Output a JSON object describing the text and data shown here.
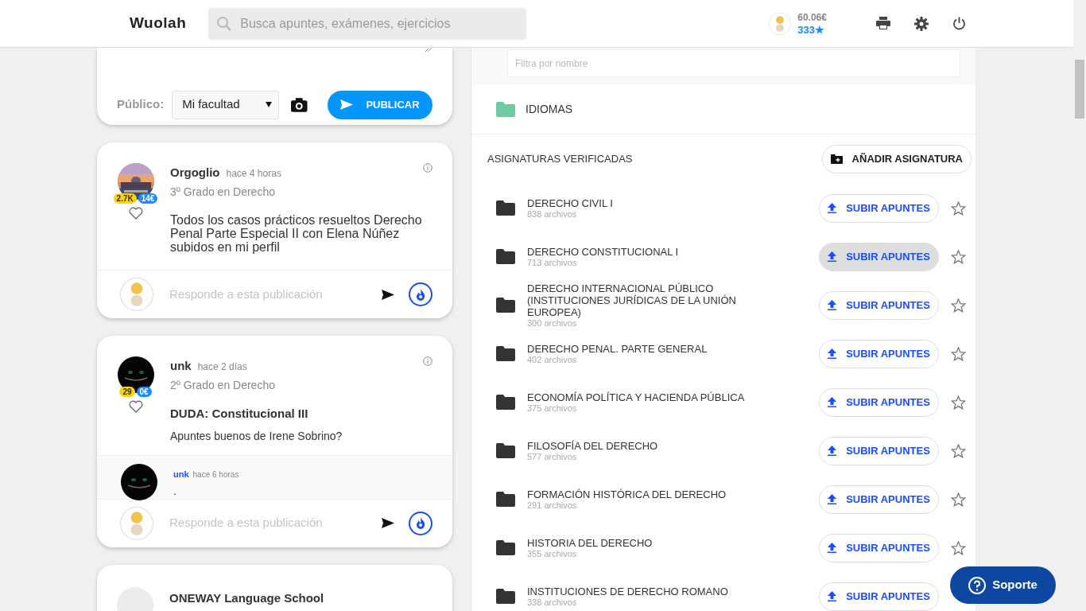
{
  "header": {
    "logo": "Wuolah",
    "search": {
      "placeholder": "Busca apuntes, exámenes, ejercicios"
    },
    "user": {
      "balance": "60.06€",
      "stars_count": "333★"
    }
  },
  "composer": {
    "audience_label": "Público:",
    "audience": "Mi facultad",
    "publish": "PUBLICAR"
  },
  "posts": [
    {
      "author": "Orgoglio",
      "time": "hace 4 horas",
      "degree": "3º Grado en Derecho",
      "points": "2.7K",
      "money": "14€",
      "liked": false,
      "body": "Todos los casos prácticos resueltos Derecho Penal Parte Especial II con Elena Núñez subidos en mi perfil",
      "reply_placeholder": "Responde a esta publicación"
    },
    {
      "author": "unk",
      "time": "hace 2 días",
      "degree": "2º Grado en Derecho",
      "points": "29",
      "money": "0€",
      "liked": false,
      "title": "DUDA: Constitucional III",
      "body": "Apuntes buenos de Irene Sobrino?",
      "comments": [
        {
          "author": "unk",
          "time": "hace 6 horas",
          "text": "."
        }
      ],
      "reply_placeholder": "Responde a esta publicación"
    }
  ],
  "sponsored": {
    "name": "ONEWAY Language School"
  },
  "subjects_panel": {
    "filter": {
      "placeholder": "Filtra por nombre"
    },
    "folders": [
      {
        "name": "IDIOMAS"
      }
    ],
    "heading": "ASIGNATURAS VERIFICADAS",
    "add_button": "AÑADIR ASIGNATURA",
    "subjects": [
      {
        "name": "DERECHO CIVIL I",
        "files": "838 archivos",
        "upload": "SUBIR APUNTES",
        "highlighted": false,
        "favorite": false
      },
      {
        "name": "DERECHO CONSTITUCIONAL I",
        "files": "713 archivos",
        "upload": "SUBIR APUNTES",
        "highlighted": true,
        "favorite": false
      },
      {
        "name": "DERECHO INTERNACIONAL PÚBLICO (INSTITUCIONES JURÍDICAS DE LA UNIÓN EUROPEA)",
        "files": "300 archivos",
        "upload": "SUBIR APUNTES",
        "highlighted": false,
        "favorite": false
      },
      {
        "name": "DERECHO PENAL. PARTE GENERAL",
        "files": "402 archivos",
        "upload": "SUBIR APUNTES",
        "highlighted": false,
        "favorite": false
      },
      {
        "name": "ECONOMÍA POLÍTICA Y HACIENDA PÚBLICA",
        "files": "375 archivos",
        "upload": "SUBIR APUNTES",
        "highlighted": false,
        "favorite": false
      },
      {
        "name": "FILOSOFÍA DEL DERECHO",
        "files": "577 archivos",
        "upload": "SUBIR APUNTES",
        "highlighted": false,
        "favorite": false
      },
      {
        "name": "FORMACIÓN HISTÓRICA DEL DERECHO",
        "files": "291 archivos",
        "upload": "SUBIR APUNTES",
        "highlighted": false,
        "favorite": false
      },
      {
        "name": "HISTORIA DEL DERECHO",
        "files": "355 archivos",
        "upload": "SUBIR APUNTES",
        "highlighted": false,
        "favorite": false
      },
      {
        "name": "INSTITUCIONES DE DERECHO ROMANO",
        "files": "338 archivos",
        "upload": "SUBIR APUNTES",
        "highlighted": false
      }
    ]
  },
  "support_button": "Soporte"
}
